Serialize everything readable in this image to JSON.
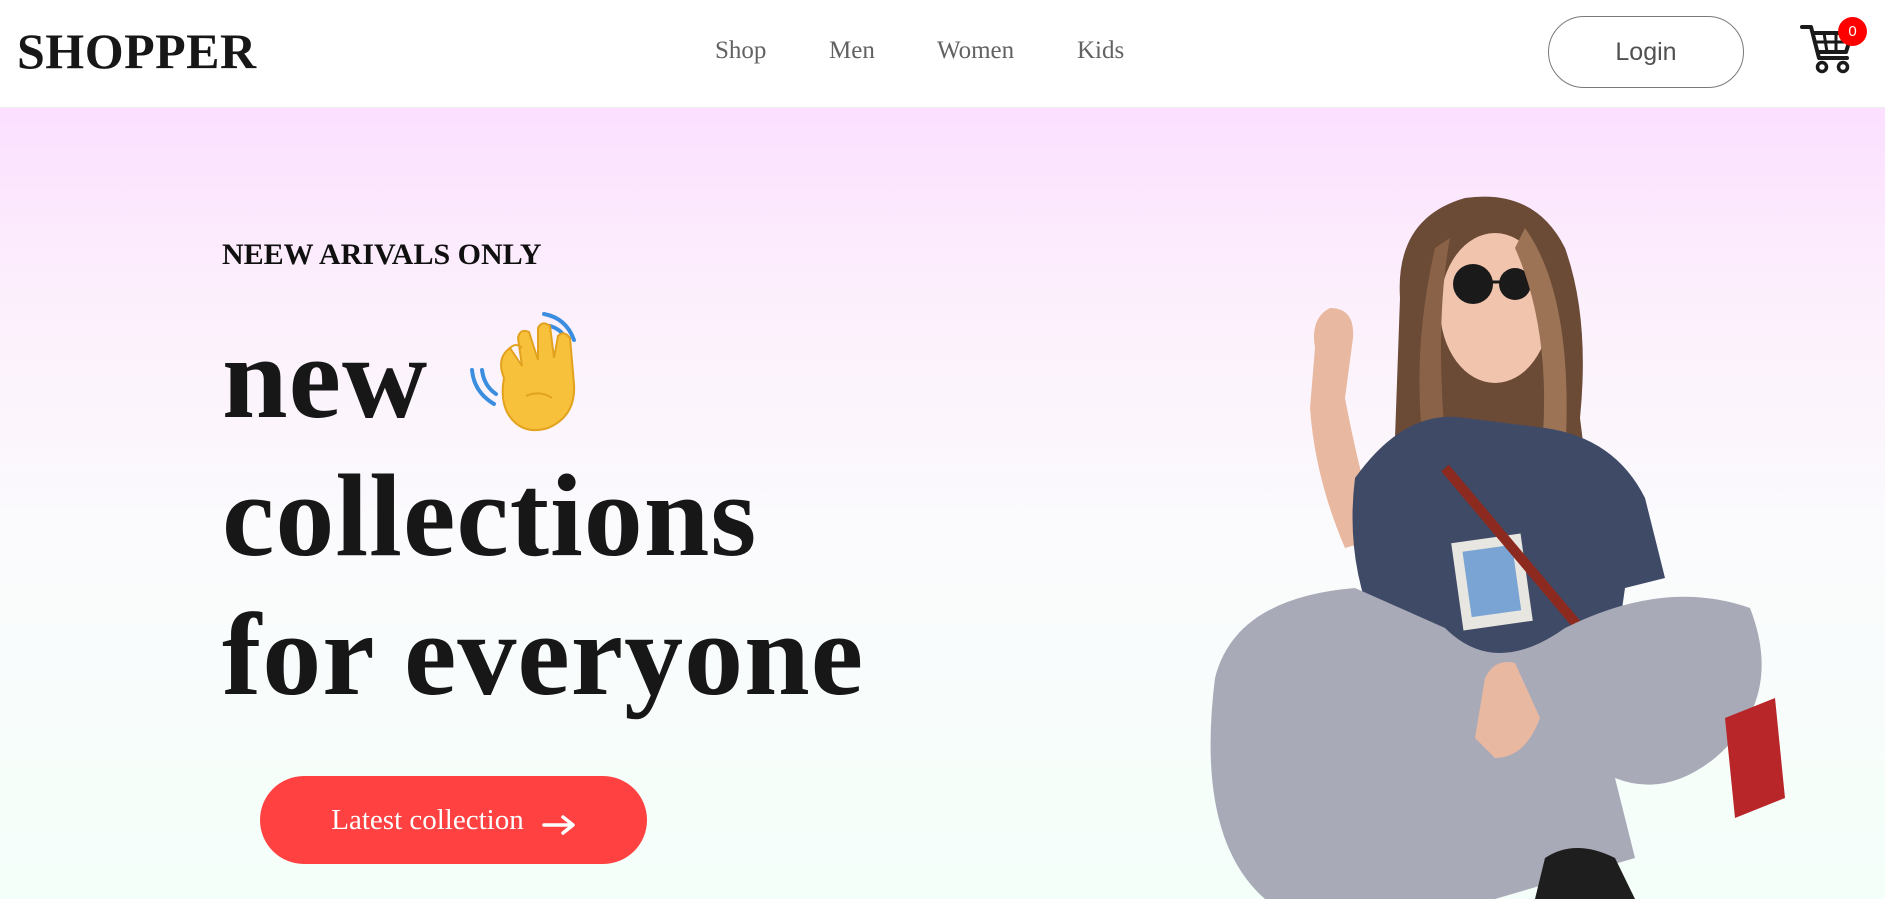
{
  "header": {
    "brand": "SHOPPER",
    "nav": [
      "Shop",
      "Men",
      "Women",
      "Kids"
    ],
    "login_label": "Login",
    "cart_count": "0",
    "cart_icon": "shopping-cart-icon"
  },
  "hero": {
    "eyebrow": "NEEW ARIVALS ONLY",
    "headline": [
      "new",
      "collections",
      "for everyone"
    ],
    "wave_icon": "waving-hand-icon",
    "cta_label": "Latest collection",
    "cta_icon": "arrow-right-icon",
    "image_icon": "model-photo"
  },
  "colors": {
    "accent": "#ff4141",
    "badge": "#ff0000",
    "gradient_top": "#fbe0ff",
    "gradient_bottom": "#f4fff9",
    "text_dark": "#171717",
    "nav_text": "#626262"
  }
}
